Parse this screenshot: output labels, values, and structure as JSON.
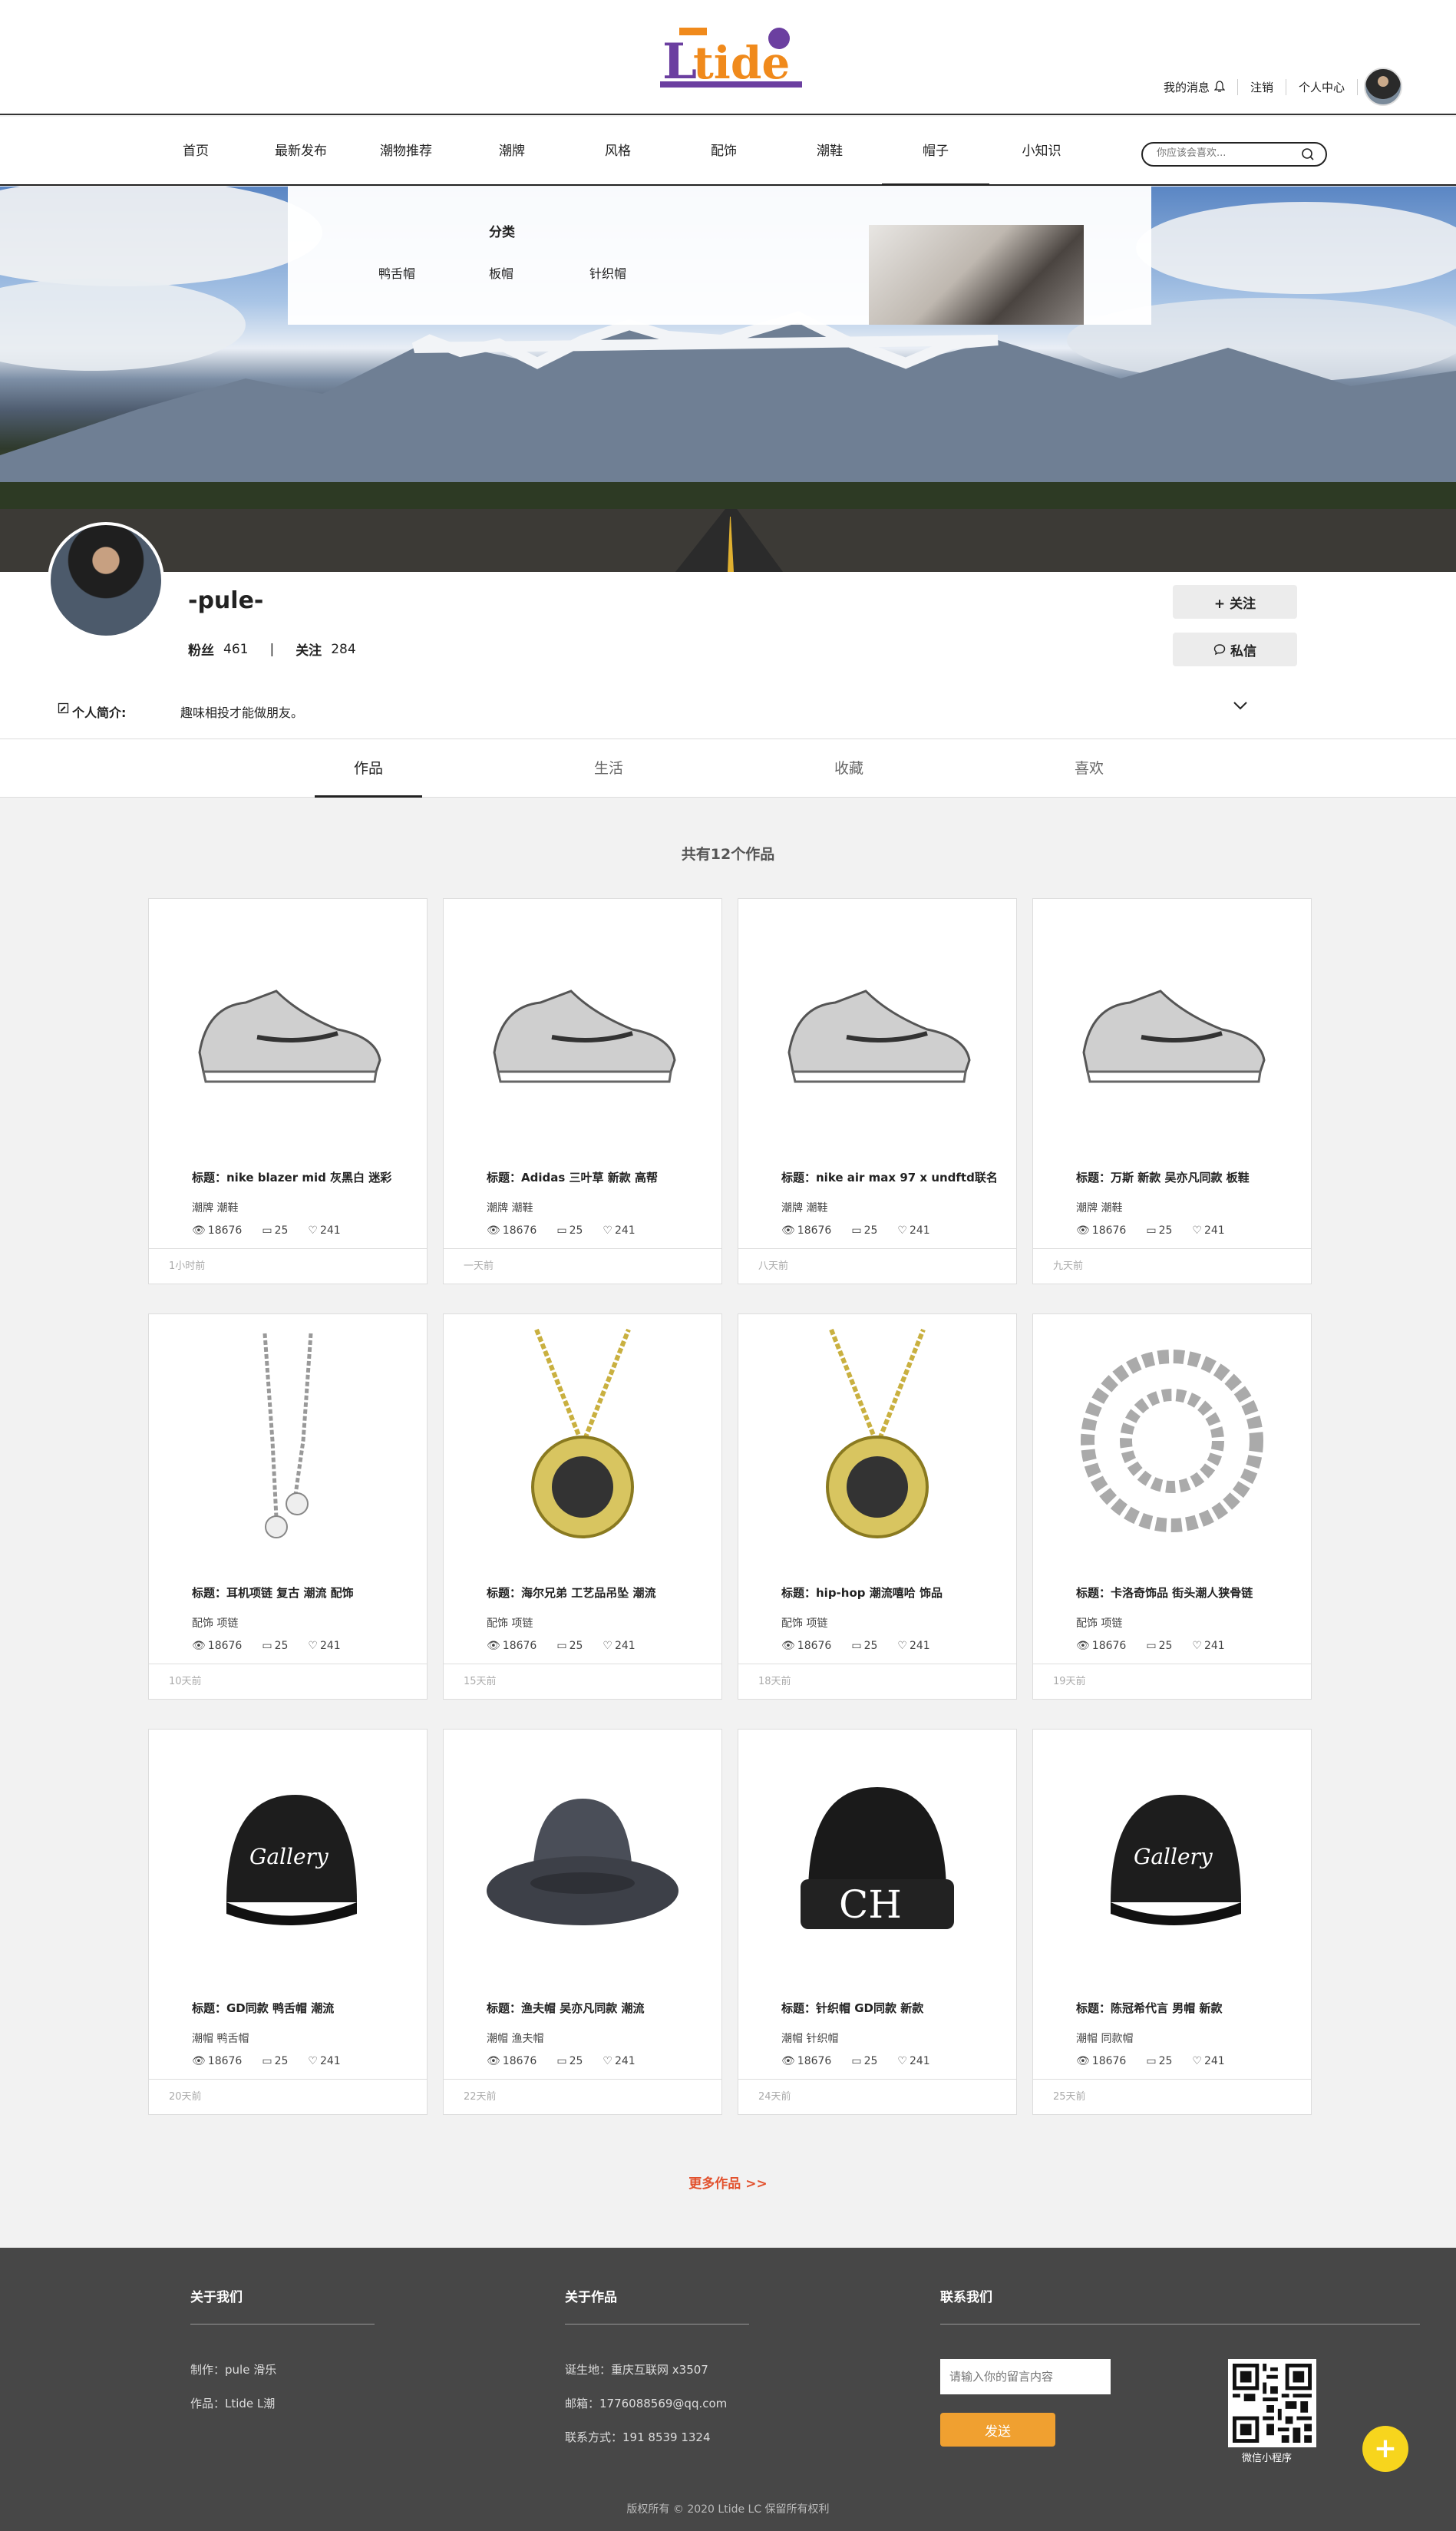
{
  "header": {
    "logo_text": "Ltide",
    "messages_label": "我的消息",
    "logout_label": "注销",
    "profile_label": "个人中心"
  },
  "nav": {
    "items": [
      "首页",
      "最新发布",
      "潮物推荐",
      "潮牌",
      "风格",
      "配饰",
      "潮鞋",
      "帽子",
      "小知识"
    ],
    "active": "帽子",
    "search_placeholder": "你应该会喜欢..."
  },
  "dropdown": {
    "title": "分类",
    "items": [
      "鸭舌帽",
      "板帽",
      "针织帽"
    ]
  },
  "profile": {
    "name": "-pule-",
    "fans_label": "粉丝",
    "fans": "461",
    "separator": "|",
    "follow_label": "关注",
    "follow": "284",
    "follow_button": "+ 关注",
    "message_button": "私信",
    "bio_label": "个人简介:",
    "bio_text": "趣味相投才能做朋友。"
  },
  "tabs": [
    "作品",
    "生活",
    "收藏",
    "喜欢"
  ],
  "works_count_text": "共有12个作品",
  "cards": [
    {
      "title": "标题：nike blazer mid 灰黑白 迷彩",
      "tags": "潮牌 潮鞋",
      "views": "18676",
      "comments": "25",
      "likes": "241",
      "time": "1小时前",
      "icon": "sneaker-icon"
    },
    {
      "title": "标题：Adidas 三叶草 新款 高帮",
      "tags": "潮牌 潮鞋",
      "views": "18676",
      "comments": "25",
      "likes": "241",
      "time": "一天前",
      "icon": "sneaker-icon"
    },
    {
      "title": "标题：nike air max 97 x undftd联名",
      "tags": "潮牌 潮鞋",
      "views": "18676",
      "comments": "25",
      "likes": "241",
      "time": "八天前",
      "icon": "sneaker-icon"
    },
    {
      "title": "标题：万斯 新款 吴亦凡同款 板鞋",
      "tags": "潮牌 潮鞋",
      "views": "18676",
      "comments": "25",
      "likes": "241",
      "time": "九天前",
      "icon": "sneaker-icon"
    },
    {
      "title": "标题：耳机项链 复古 潮流 配饰",
      "tags": "配饰 项链",
      "views": "18676",
      "comments": "25",
      "likes": "241",
      "time": "10天前",
      "icon": "necklace-icon"
    },
    {
      "title": "标题：海尔兄弟 工艺品吊坠 潮流",
      "tags": "配饰 项链",
      "views": "18676",
      "comments": "25",
      "likes": "241",
      "time": "15天前",
      "icon": "pendant-icon"
    },
    {
      "title": "标题：hip-hop 潮流嘻哈 饰品",
      "tags": "配饰 项链",
      "views": "18676",
      "comments": "25",
      "likes": "241",
      "time": "18天前",
      "icon": "pendant-icon"
    },
    {
      "title": "标题：卡洛奇饰品 街头潮人狭骨链",
      "tags": "配饰 项链",
      "views": "18676",
      "comments": "25",
      "likes": "241",
      "time": "19天前",
      "icon": "chain-icon"
    },
    {
      "title": "标题：GD同款 鸭舌帽 潮流",
      "tags": "潮帽 鸭舌帽",
      "views": "18676",
      "comments": "25",
      "likes": "241",
      "time": "20天前",
      "icon": "cap-icon"
    },
    {
      "title": "标题：渔夫帽 吴亦凡同款 潮流",
      "tags": "潮帽 渔夫帽",
      "views": "18676",
      "comments": "25",
      "likes": "241",
      "time": "22天前",
      "icon": "bucket-hat-icon"
    },
    {
      "title": "标题：针织帽 GD同款 新款",
      "tags": "潮帽 针织帽",
      "views": "18676",
      "comments": "25",
      "likes": "241",
      "time": "24天前",
      "icon": "beanie-icon"
    },
    {
      "title": "标题：陈冠希代言 男帽 新款",
      "tags": "潮帽 同款帽",
      "views": "18676",
      "comments": "25",
      "likes": "241",
      "time": "25天前",
      "icon": "cap-icon"
    }
  ],
  "more_label": "更多作品 >>",
  "footer": {
    "about_title": "关于我们",
    "about_lines": [
      "制作：pule 滑乐",
      "作品：Ltide L潮"
    ],
    "works_title": "关于作品",
    "works_lines": [
      "诞生地：重庆互联网 x3507",
      "邮箱：1776088569@qq.com",
      "联系方式：191 8539 1324"
    ],
    "contact_title": "联系我们",
    "message_placeholder": "请输入你的留言内容",
    "send_label": "发送",
    "qr_label": "微信小程序",
    "copyright": "版权所有 © 2020 Ltide LC 保留所有权利"
  },
  "colors": {
    "accent": "#e2512d",
    "send_button": "#f0a030",
    "fab": "#f7d51d",
    "footer_bg": "#474747"
  }
}
